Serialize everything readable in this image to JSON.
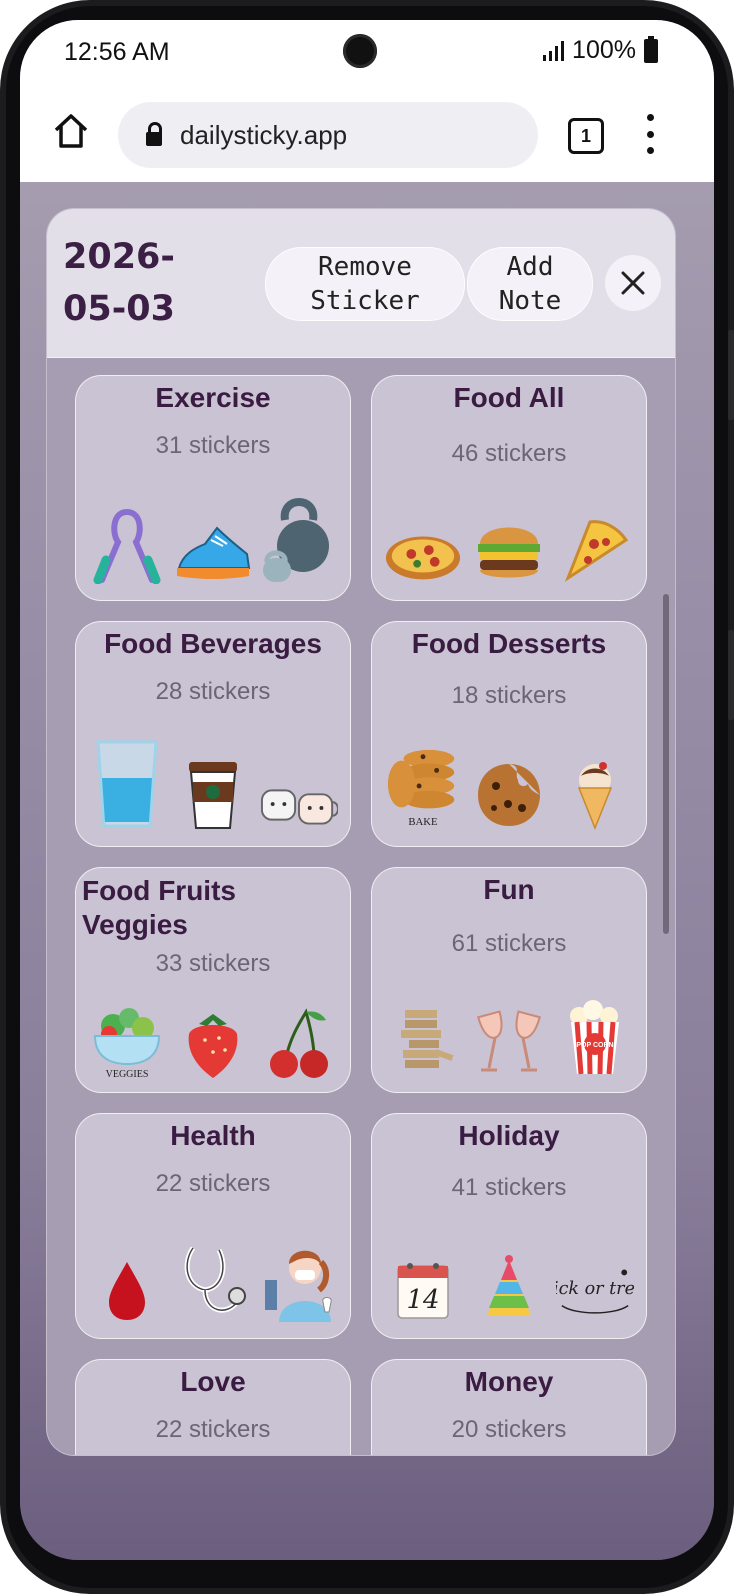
{
  "status": {
    "time": "12:56 AM",
    "battery": "100%"
  },
  "browser": {
    "url": "dailysticky.app",
    "tab_count": "1"
  },
  "header": {
    "date": "2026-05-03",
    "remove_label": "Remove Sticker",
    "add_note_label": "Add Note"
  },
  "categories": [
    {
      "name": "Exercise",
      "count": "31 stickers",
      "icons": [
        "hand-grip-icon",
        "running-shoe-icon",
        "kettlebell-icon"
      ]
    },
    {
      "name": "Food All",
      "count": "46 stickers",
      "icons": [
        "pizza-pie-icon",
        "burger-icon",
        "pizza-slice-icon"
      ]
    },
    {
      "name": "Food Beverages",
      "count": "28 stickers",
      "icons": [
        "water-glass-icon",
        "coffee-cup-icon",
        "mugs-icon"
      ]
    },
    {
      "name": "Food Desserts",
      "count": "18 stickers",
      "icons": [
        "cookie-stack-icon",
        "cookie-icon",
        "ice-cream-icon"
      ]
    },
    {
      "name": "Food Fruits Veggies",
      "count": "33 stickers",
      "icons": [
        "veggie-bowl-icon",
        "strawberry-icon",
        "cherries-icon"
      ]
    },
    {
      "name": "Fun",
      "count": "61 stickers",
      "icons": [
        "jenga-icon",
        "wine-toast-icon",
        "popcorn-icon"
      ]
    },
    {
      "name": "Health",
      "count": "22 stickers",
      "icons": [
        "blood-drop-icon",
        "stethoscope-icon",
        "dentist-icon"
      ]
    },
    {
      "name": "Holiday",
      "count": "41 stickers",
      "icons": [
        "calendar-icon",
        "party-hat-icon",
        "trick-or-treat-icon"
      ]
    },
    {
      "name": "Love",
      "count": "22 stickers"
    },
    {
      "name": "Money",
      "count": "20 stickers"
    }
  ],
  "sticker_labels": {
    "bake": "BAKE",
    "veggies": "VEGGIES",
    "calendar_day": "14",
    "popcorn": "POP CORN",
    "trick_or_treat": "trick or treat"
  }
}
